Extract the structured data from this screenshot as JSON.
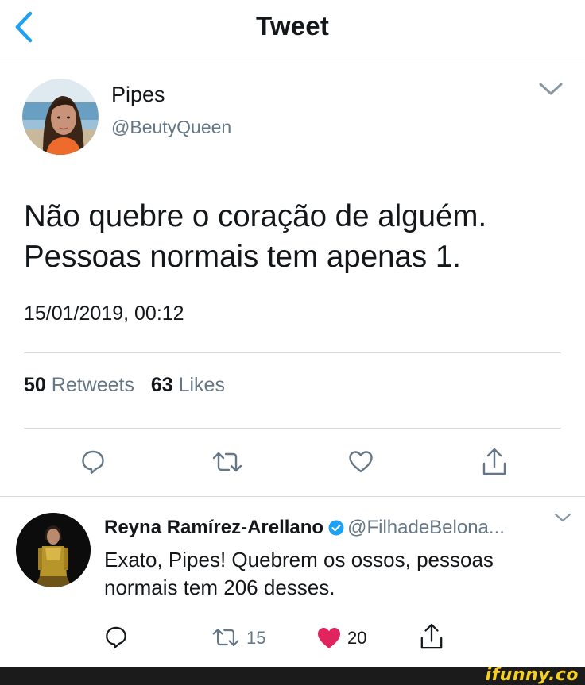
{
  "header": {
    "title": "Tweet",
    "back_icon": "chevron-left-icon",
    "accent": "#1da1f2"
  },
  "tweet": {
    "author_name": "Pipes",
    "author_handle": "@BeutyQueen",
    "text_line1": "Não quebre o coração de alguém.",
    "text_line2": "Pessoas normais tem apenas 1.",
    "timestamp": "15/01/2019, 00:12",
    "retweets_count": "50",
    "retweets_label": "Retweets",
    "likes_count": "63",
    "likes_label": "Likes",
    "actions": [
      "reply-icon",
      "retweet-icon",
      "heart-outline-icon",
      "share-icon"
    ]
  },
  "reply": {
    "author_name": "Reyna Ramírez-Arellano",
    "verified": true,
    "author_handle": "@FilhadeBelona...",
    "text_line1": "Exato, Pipes! Quebrem os ossos, pessoas",
    "text_line2": "normais tem 206 desses.",
    "retweets_count": "15",
    "likes_count": "20",
    "liked": true,
    "like_color": "#e0245e",
    "verified_color": "#1da1f2"
  },
  "watermark": "ifunny.co"
}
